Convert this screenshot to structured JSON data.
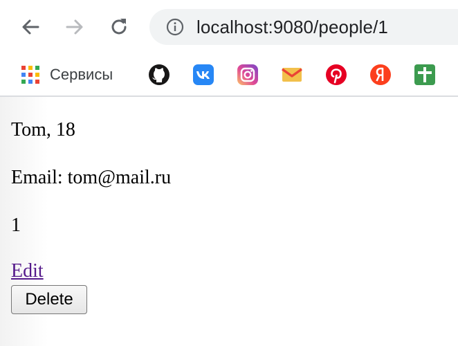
{
  "browser": {
    "url": "localhost:9080/people/1",
    "icons": {
      "back": "arrow-left-icon",
      "forward": "arrow-right-icon",
      "reload": "reload-icon",
      "site_info": "info-icon"
    }
  },
  "bookmarks_bar": {
    "apps_label": "Сервисы",
    "items": [
      {
        "icon": "github-icon",
        "color": "#181717"
      },
      {
        "icon": "vk-icon",
        "color": "#2787f5"
      },
      {
        "icon": "instagram-icon",
        "color": "#c13584"
      },
      {
        "icon": "gmail-icon",
        "color": "#ea4335"
      },
      {
        "icon": "pinterest-icon",
        "color": "#e60023"
      },
      {
        "icon": "yandex-icon",
        "color": "#fc3f1d"
      },
      {
        "icon": "google-plus-icon",
        "color": "#3c9b4f"
      }
    ]
  },
  "person": {
    "name_age": "Tom, 18",
    "email_line": "Email: tom@mail.ru",
    "id": "1"
  },
  "actions": {
    "edit_label": "Edit",
    "delete_label": "Delete"
  }
}
